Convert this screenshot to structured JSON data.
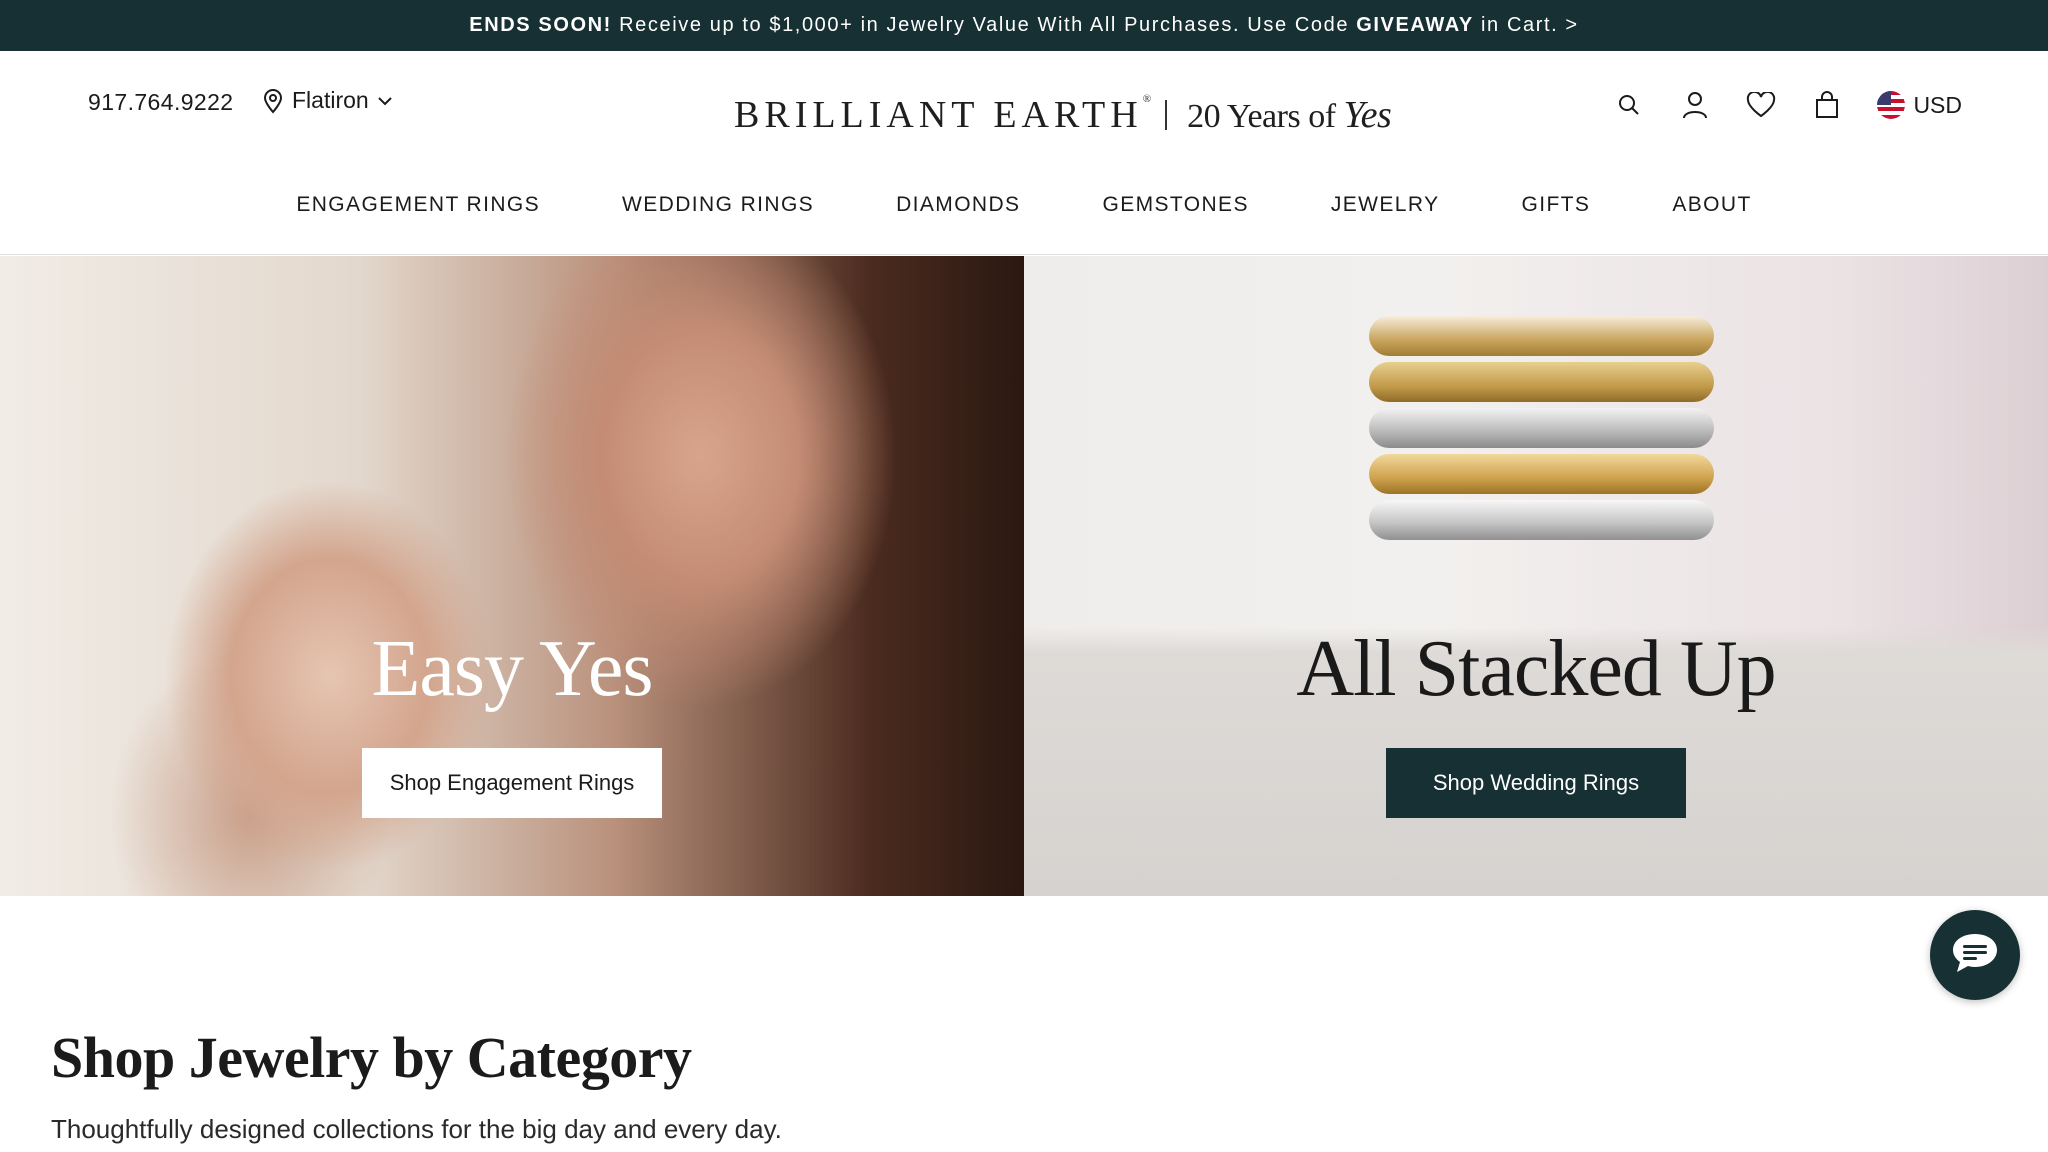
{
  "promo": {
    "strong": "ENDS SOON!",
    "text_before_code": " Receive up to $1,000+ in Jewelry Value With All Purchases. Use Code ",
    "code": "GIVEAWAY",
    "text_after_code": " in Cart. >"
  },
  "header": {
    "phone": "917.764.9222",
    "location": "Flatiron",
    "logo": {
      "brand": "BRILLIANT EARTH",
      "reg": "®",
      "tagline_prefix": "20 Years of ",
      "tagline_script": "Yes"
    },
    "currency": "USD",
    "icons": [
      "search-icon",
      "account-icon",
      "heart-icon",
      "bag-icon",
      "flag-icon"
    ]
  },
  "nav": {
    "items": [
      "ENGAGEMENT RINGS",
      "WEDDING RINGS",
      "DIAMONDS",
      "GEMSTONES",
      "JEWELRY",
      "GIFTS",
      "ABOUT"
    ]
  },
  "hero": {
    "left": {
      "title": "Easy Yes",
      "button": "Shop Engagement Rings"
    },
    "right": {
      "title": "All Stacked Up",
      "button": "Shop Wedding Rings"
    }
  },
  "category": {
    "title": "Shop Jewelry by Category",
    "subtitle": "Thoughtfully designed collections for the big day and every day."
  },
  "colors": {
    "brand_dark": "#173033",
    "white": "#ffffff"
  }
}
